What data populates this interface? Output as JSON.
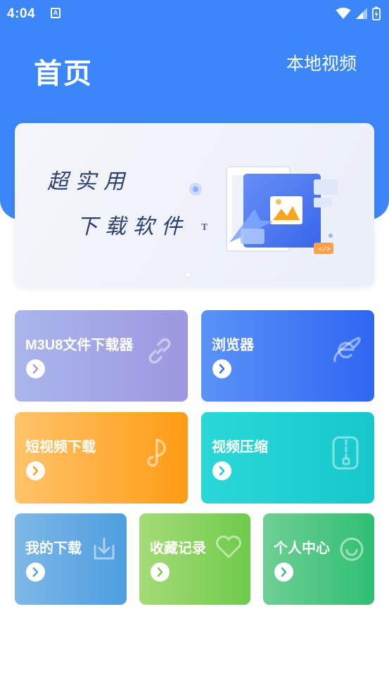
{
  "status_bar": {
    "time": "4:04",
    "notification_icon": "A"
  },
  "header": {
    "title": "首页",
    "local_video_label": "本地视频"
  },
  "banner": {
    "line1": "超实用",
    "line2": "下载软件"
  },
  "tiles": [
    {
      "label": "M3U8文件下载器",
      "icon": "link-icon",
      "color": "#9d97e0"
    },
    {
      "label": "浏览器",
      "icon": "browser-e-icon",
      "color": "#2f66f3"
    },
    {
      "label": "短视频下载",
      "icon": "music-note-icon",
      "color": "#ff9b14"
    },
    {
      "label": "视频压缩",
      "icon": "compress-file-icon",
      "color": "#17c7cc"
    },
    {
      "label": "我的下载",
      "icon": "download-tray-icon",
      "color": "#4d9ee0"
    },
    {
      "label": "收藏记录",
      "icon": "heart-icon",
      "color": "#6ecb4a"
    },
    {
      "label": "个人中心",
      "icon": "smiley-icon",
      "color": "#2fbf72"
    }
  ],
  "colors": {
    "header_blue": "#3b86f9"
  }
}
